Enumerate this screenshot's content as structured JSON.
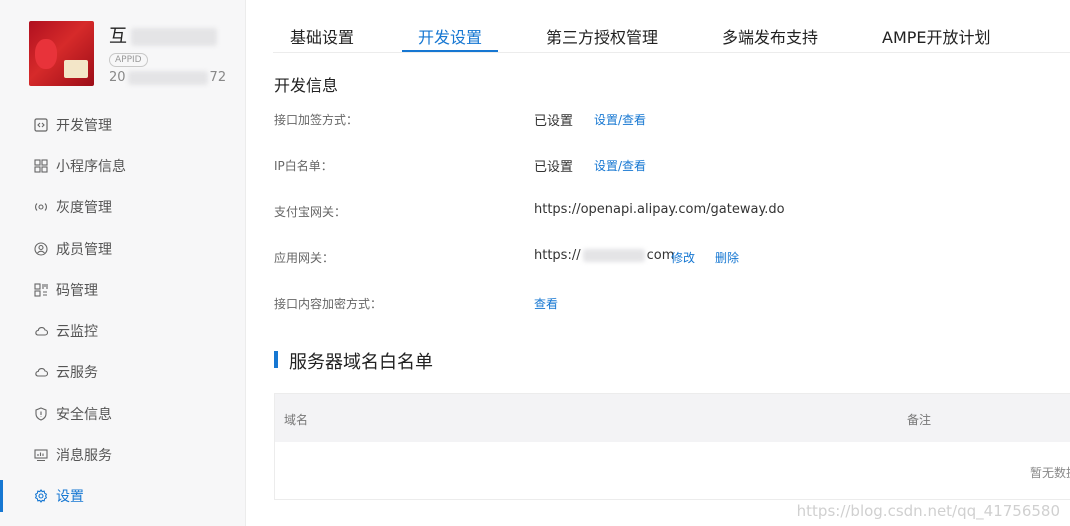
{
  "app": {
    "name_prefix": "互",
    "appid_tag": "APPID",
    "id_prefix": "20",
    "id_suffix": "72"
  },
  "sidebar": {
    "items": [
      {
        "label": "开发管理",
        "icon": "code-icon"
      },
      {
        "label": "小程序信息",
        "icon": "grid-icon"
      },
      {
        "label": "灰度管理",
        "icon": "broadcast-icon"
      },
      {
        "label": "成员管理",
        "icon": "user-circle-icon"
      },
      {
        "label": "码管理",
        "icon": "qrcode-icon"
      },
      {
        "label": "云监控",
        "icon": "cloud-icon"
      },
      {
        "label": "云服务",
        "icon": "cloud-icon"
      },
      {
        "label": "安全信息",
        "icon": "shield-icon"
      },
      {
        "label": "消息服务",
        "icon": "monitor-chart-icon"
      },
      {
        "label": "设置",
        "icon": "gear-icon",
        "active": true
      }
    ]
  },
  "tabs": [
    "基础设置",
    "开发设置",
    "第三方授权管理",
    "多端发布支持",
    "AMPE开放计划"
  ],
  "active_tab": "开发设置",
  "dev_info": {
    "title": "开发信息",
    "sign_method": {
      "label": "接口加签方式：",
      "value": "已设置",
      "link": "设置/查看"
    },
    "ip_whitelist": {
      "label": "IP白名单：",
      "value": "已设置",
      "link": "设置/查看"
    },
    "alipay_gateway": {
      "label": "支付宝网关：",
      "value": "https://openapi.alipay.com/gateway.do"
    },
    "app_gateway": {
      "label": "应用网关：",
      "value_prefix": "https://",
      "value_suffix": "com",
      "edit": "修改",
      "delete": "删除"
    },
    "content_encrypt": {
      "label": "接口内容加密方式：",
      "link": "查看"
    }
  },
  "domain_whitelist": {
    "title": "服务器域名白名单",
    "col_domain": "域名",
    "col_note": "备注",
    "empty_text": "暂无数据"
  },
  "watermark": "https://blog.csdn.net/qq_41756580",
  "colors": {
    "accent": "#1677d2",
    "sidebar_bg": "#f7f7f8"
  }
}
